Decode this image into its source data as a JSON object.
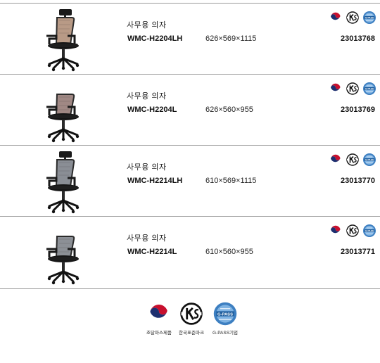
{
  "products": [
    {
      "name": "사무용 의자",
      "model": "WMC-H2204LH",
      "size": "626×569×1115",
      "code": "23013768",
      "headrest": true,
      "back_color": "#b89a86"
    },
    {
      "name": "사무용 의자",
      "model": "WMC-H2204L",
      "size": "626×560×955",
      "code": "23013769",
      "headrest": false,
      "back_color": "#a08884"
    },
    {
      "name": "사무용 의자",
      "model": "WMC-H2214LH",
      "size": "610×569×1115",
      "code": "23013770",
      "headrest": true,
      "back_color": "#8a8e95"
    },
    {
      "name": "사무용 의자",
      "model": "WMC-H2214L",
      "size": "610×560×955",
      "code": "23013771",
      "headrest": false,
      "back_color": "#8c9096"
    }
  ],
  "certification_icons": [
    "excellent-procurement-mark-icon",
    "ks-mark-icon",
    "gpass-mark-icon"
  ],
  "legend": {
    "items": [
      {
        "icon": "excellent-procurement-mark-icon",
        "label": "조달마스제품"
      },
      {
        "icon": "ks-mark-icon",
        "label": "한국표준마크"
      },
      {
        "icon": "gpass-mark-icon",
        "label": "G-PASS기업"
      }
    ]
  },
  "colors": {
    "divider": "#9a9a9a",
    "mark_red": "#c8102e",
    "mark_navy": "#1d2f6f",
    "gpass_blue": "#3d7fc1"
  }
}
